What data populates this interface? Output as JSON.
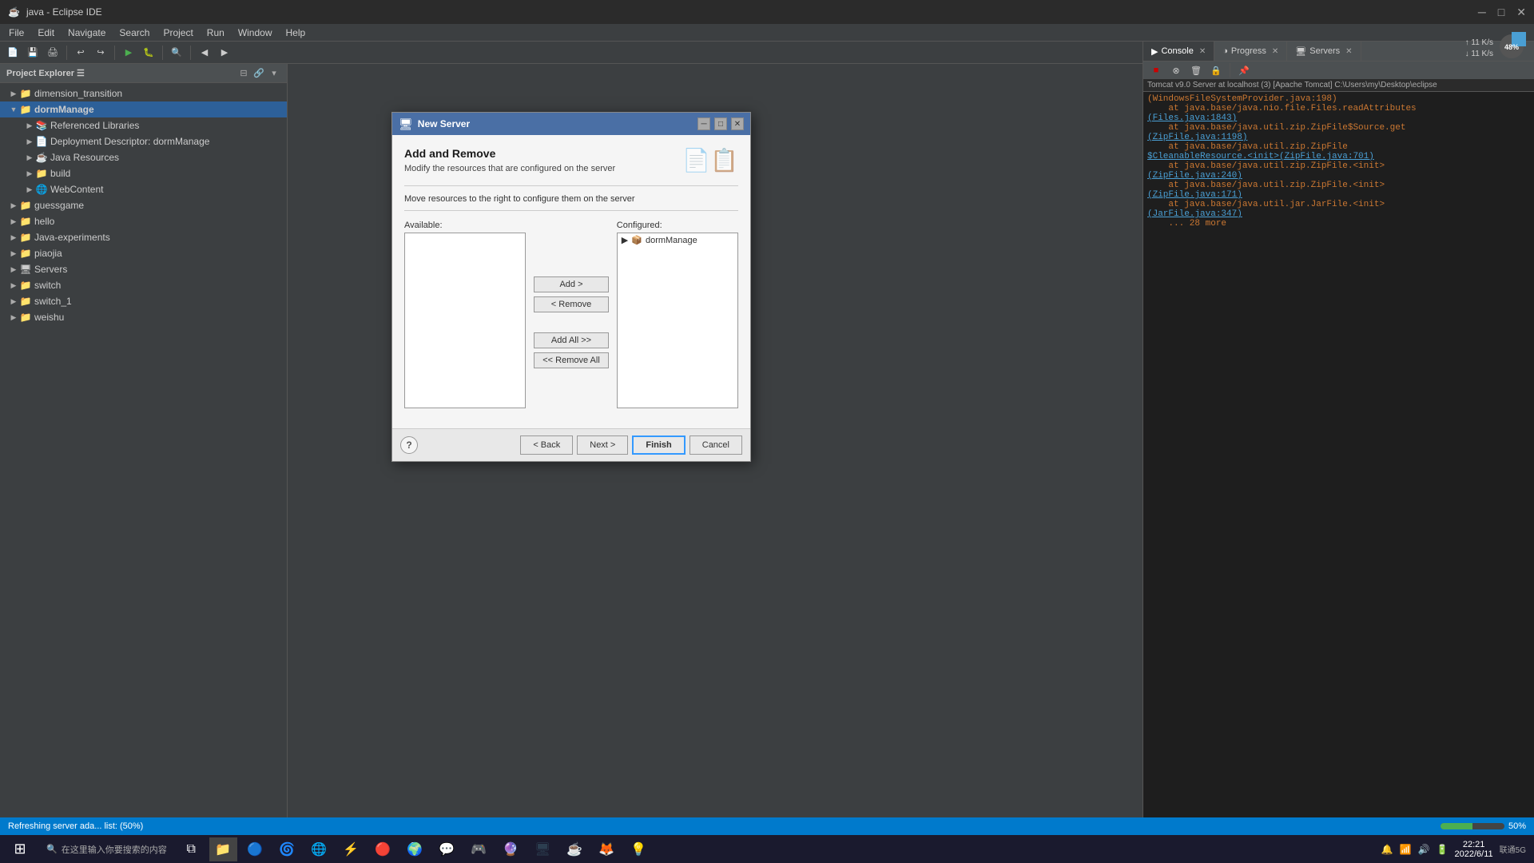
{
  "window": {
    "title": "java - Eclipse IDE",
    "min_btn": "─",
    "max_btn": "□",
    "close_btn": "✕"
  },
  "menu": {
    "items": [
      "File",
      "Edit",
      "Navigate",
      "Search",
      "Project",
      "Run",
      "Window",
      "Help"
    ]
  },
  "left_panel": {
    "title": "Project Explorer ☰",
    "tree": [
      {
        "label": "dimension_transition",
        "indent": 0,
        "arrow": "▶",
        "icon": "📁",
        "type": "folder"
      },
      {
        "label": "dormManage",
        "indent": 0,
        "arrow": "▼",
        "icon": "📁",
        "type": "folder",
        "selected": true,
        "bold": true
      },
      {
        "label": "Referenced Libraries",
        "indent": 1,
        "arrow": "▶",
        "icon": "📚",
        "type": "lib"
      },
      {
        "label": "Deployment Descriptor: dormManage",
        "indent": 1,
        "arrow": "▶",
        "icon": "📄",
        "type": "descriptor"
      },
      {
        "label": "Java Resources",
        "indent": 1,
        "arrow": "▶",
        "icon": "☕",
        "type": "java"
      },
      {
        "label": "build",
        "indent": 1,
        "arrow": "▶",
        "icon": "📁",
        "type": "folder"
      },
      {
        "label": "WebContent",
        "indent": 1,
        "arrow": "▶",
        "icon": "🌐",
        "type": "web"
      },
      {
        "label": "guessgame",
        "indent": 0,
        "arrow": "▶",
        "icon": "📁",
        "type": "folder"
      },
      {
        "label": "hello",
        "indent": 0,
        "arrow": "▶",
        "icon": "📁",
        "type": "folder"
      },
      {
        "label": "Java-experiments",
        "indent": 0,
        "arrow": "▶",
        "icon": "📁",
        "type": "folder"
      },
      {
        "label": "piaojia",
        "indent": 0,
        "arrow": "▶",
        "icon": "📁",
        "type": "folder"
      },
      {
        "label": "Servers",
        "indent": 0,
        "arrow": "▶",
        "icon": "🖥",
        "type": "server"
      },
      {
        "label": "switch",
        "indent": 0,
        "arrow": "▶",
        "icon": "📁",
        "type": "folder"
      },
      {
        "label": "switch_1",
        "indent": 0,
        "arrow": "▶",
        "icon": "📁",
        "type": "folder"
      },
      {
        "label": "weishu",
        "indent": 0,
        "arrow": "▶",
        "icon": "📁",
        "type": "folder"
      }
    ]
  },
  "right_tabs": {
    "tabs": [
      {
        "label": "Console",
        "icon": "▶",
        "active": true
      },
      {
        "label": "Progress",
        "icon": "◑",
        "active": false
      },
      {
        "label": "Servers",
        "icon": "🖥",
        "active": false
      }
    ]
  },
  "console": {
    "title": "Tomcat v9.0 Server at localhost (3) [Apache Tomcat] C:\\Users\\my\\Desktop\\eclipse",
    "lines": [
      {
        "text": "(WindowsFileSystemProvider.java:198)",
        "type": "red"
      },
      {
        "text": "        at java.base/java.nio.file.Files.readAttributes",
        "type": "red"
      },
      {
        "text": "(Files.java:1843)",
        "type": "link"
      },
      {
        "text": "        at java.base/java.util.zip.ZipFile$Source.get",
        "type": "red"
      },
      {
        "text": "(ZipFile.java:1198)",
        "type": "link"
      },
      {
        "text": "        at java.base/java.util.zip.ZipFile",
        "type": "red"
      },
      {
        "text": "$CleanableResource.<init>(ZipFile.java:701)",
        "type": "link"
      },
      {
        "text": "        at java.base/java.util.zip.ZipFile.<init>",
        "type": "red"
      },
      {
        "text": "(ZipFile.java:240)",
        "type": "link"
      },
      {
        "text": "        at java.base/java.util.zip.ZipFile.<init>",
        "type": "red"
      },
      {
        "text": "(ZipFile.java:171)",
        "type": "link"
      },
      {
        "text": "        at java.base/java.util.jar.JarFile.<init>",
        "type": "red"
      },
      {
        "text": "(JarFile.java:347)",
        "type": "link"
      },
      {
        "text": "        ... 28 more",
        "type": "red"
      }
    ]
  },
  "network": {
    "upload": "↑ 11 K/s",
    "download": "↓ 11 K/s"
  },
  "progress_circle": {
    "value": 48,
    "label": "48%"
  },
  "dialog": {
    "title": "New Server",
    "section_title": "Add and Remove",
    "section_desc": "Modify the resources that are configured on the server",
    "instruction": "Move resources to the right to configure them on the server",
    "available_label": "Available:",
    "configured_label": "Configured:",
    "available_items": [],
    "configured_items": [
      {
        "label": "dormManage",
        "icon": "📦"
      }
    ],
    "buttons": {
      "add": "Add >",
      "remove": "< Remove",
      "add_all": "Add All >>",
      "remove_all": "<< Remove All"
    },
    "footer_buttons": {
      "back": "< Back",
      "next": "Next >",
      "finish": "Finish",
      "cancel": "Cancel"
    }
  },
  "status_bar": {
    "text": "Refreshing server ada... list: (50%)"
  },
  "taskbar": {
    "time": "22:21",
    "date": "2022/6/11",
    "carrier": "联通5G"
  }
}
